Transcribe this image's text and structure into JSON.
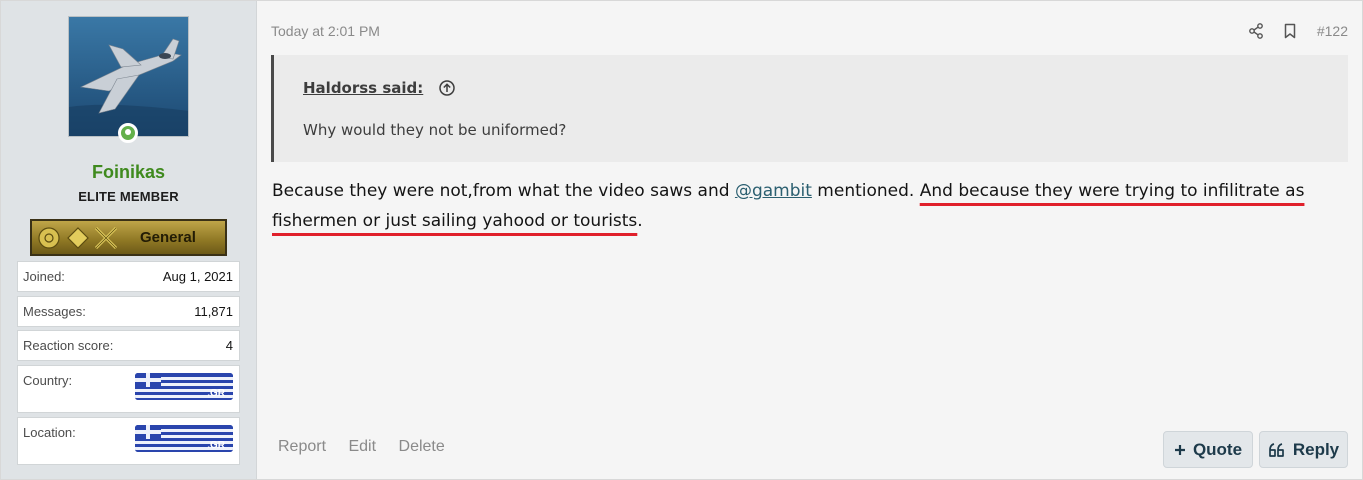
{
  "user": {
    "name": "Foinikas",
    "title": "ELITE MEMBER",
    "rank": "General",
    "stats": [
      {
        "label": "Joined:",
        "value": "Aug 1, 2021"
      },
      {
        "label": "Messages:",
        "value": "11,871"
      },
      {
        "label": "Reaction score:",
        "value": "4"
      }
    ],
    "country": {
      "label": "Country:",
      "flag_text": ".GR"
    },
    "location": {
      "label": "Location:",
      "flag_text": ".GR"
    }
  },
  "post": {
    "timestamp": "Today at 2:01 PM",
    "number": "#122",
    "quote": {
      "author": "Haldorss said:",
      "text": "Why would they not be uniformed?"
    },
    "message": {
      "part1": "Because they were not,from what the video saws and ",
      "mention": "@gambit",
      "part2": " mentioned. ",
      "highlight": "And because they were trying to infilitrate as fishermen or just sailing yahood or tourists",
      "end": "."
    },
    "actions": {
      "report": "Report",
      "edit": "Edit",
      "delete": "Delete",
      "quote": "Quote",
      "reply": "Reply"
    }
  },
  "colors": {
    "username": "#3f8a1e",
    "mention": "#2b5f70",
    "highlight_underline": "#e0202b",
    "sidebar_bg": "#dfe3e6",
    "button_bg": "#e3e7ea"
  }
}
